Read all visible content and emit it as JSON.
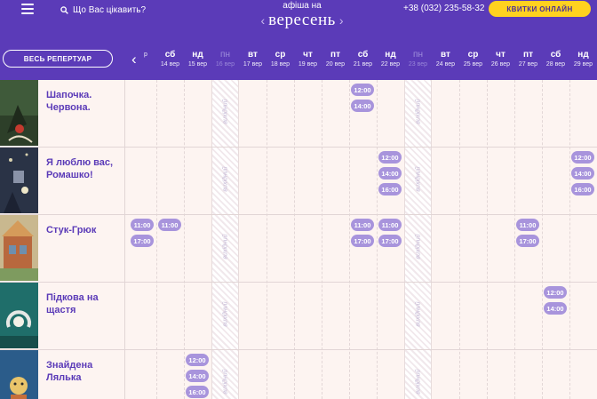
{
  "header": {
    "search_placeholder": "Що Вас цікавить?",
    "month_caption": "афіша на",
    "month_name": "вересень",
    "prev_month": "‹",
    "next_month": "›",
    "phone": "+38 (032) 235-58-32",
    "tickets_button": "КВИТКИ ОНЛАЙН",
    "repertoire_button": "ВЕСЬ РЕПЕРТУАР",
    "days_prev": "‹"
  },
  "colors": {
    "header": "#5b3bb8",
    "accent": "#ffd21f",
    "time_badge": "#a894dc",
    "background": "#fdf4f1"
  },
  "days": [
    {
      "dow": "",
      "date": "р",
      "off": false
    },
    {
      "dow": "сб",
      "date": "14 вер",
      "off": false
    },
    {
      "dow": "нд",
      "date": "15 вер",
      "off": false
    },
    {
      "dow": "пн",
      "date": "16 вер",
      "off": true
    },
    {
      "dow": "вт",
      "date": "17 вер",
      "off": false
    },
    {
      "dow": "ср",
      "date": "18 вер",
      "off": false
    },
    {
      "dow": "чт",
      "date": "19 вер",
      "off": false
    },
    {
      "dow": "пт",
      "date": "20 вер",
      "off": false
    },
    {
      "dow": "сб",
      "date": "21 вер",
      "off": false
    },
    {
      "dow": "нд",
      "date": "22 вер",
      "off": false
    },
    {
      "dow": "пн",
      "date": "23 вер",
      "off": true
    },
    {
      "dow": "вт",
      "date": "24 вер",
      "off": false
    },
    {
      "dow": "ср",
      "date": "25 вер",
      "off": false
    },
    {
      "dow": "чт",
      "date": "26 вер",
      "off": false
    },
    {
      "dow": "пт",
      "date": "27 вер",
      "off": false
    },
    {
      "dow": "сб",
      "date": "28 вер",
      "off": false
    },
    {
      "dow": "нд",
      "date": "29 вер",
      "off": false
    }
  ],
  "day_off_label": "вихідний",
  "shows": [
    {
      "title": "Шапочка. Червона.",
      "sessions": [
        {
          "day": 8,
          "times": [
            "12:00",
            "14:00"
          ]
        }
      ]
    },
    {
      "title": "Я люблю вас, Ромашко!",
      "sessions": [
        {
          "day": 9,
          "times": [
            "12:00",
            "14:00",
            "16:00"
          ]
        },
        {
          "day": 16,
          "times": [
            "12:00",
            "14:00",
            "16:00"
          ]
        }
      ]
    },
    {
      "title": "Стук-Грюк",
      "sessions": [
        {
          "day": 0,
          "times": [
            "11:00",
            "17:00"
          ]
        },
        {
          "day": 1,
          "times": [
            "11:00"
          ]
        },
        {
          "day": 8,
          "times": [
            "11:00",
            "17:00"
          ]
        },
        {
          "day": 9,
          "times": [
            "11:00",
            "17:00"
          ]
        },
        {
          "day": 14,
          "times": [
            "11:00",
            "17:00"
          ]
        }
      ]
    },
    {
      "title": "Підкова на щастя",
      "sessions": [
        {
          "day": 15,
          "times": [
            "12:00",
            "14:00"
          ]
        }
      ]
    },
    {
      "title": "Знайдена Лялька",
      "sessions": [
        {
          "day": 2,
          "times": [
            "12:00",
            "14:00",
            "16:00"
          ]
        }
      ]
    }
  ]
}
